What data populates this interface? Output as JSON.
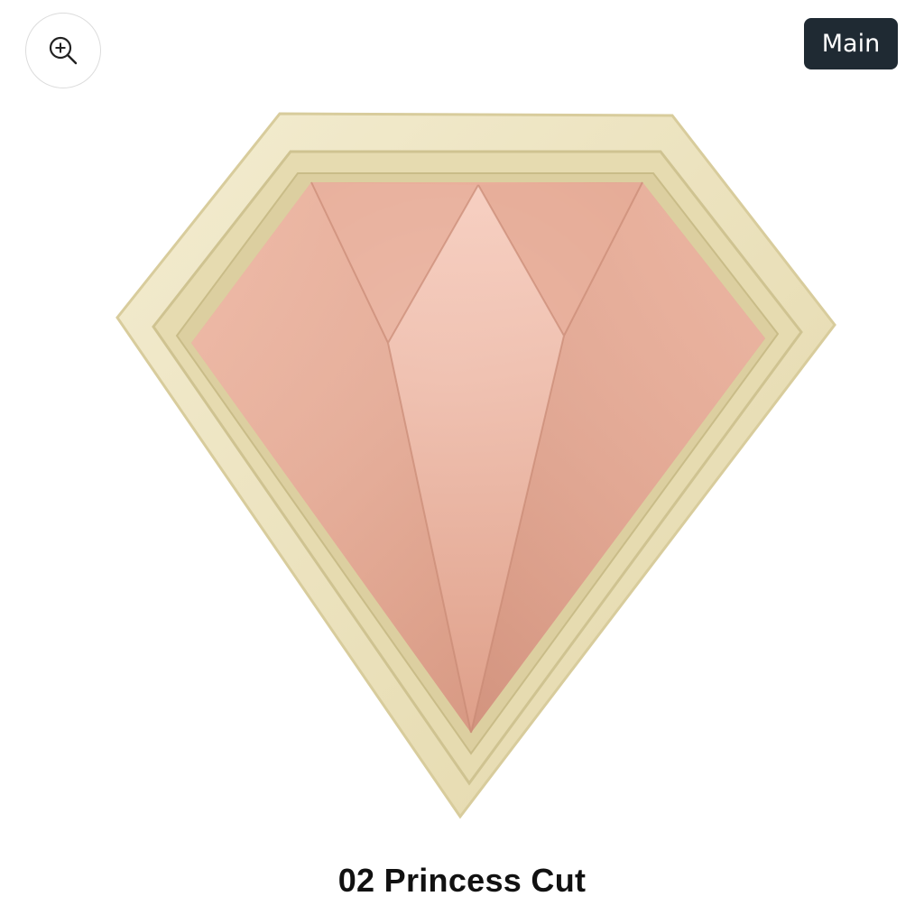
{
  "toolbar": {
    "zoom_icon": "zoom-in-icon",
    "badge_label": "Main"
  },
  "product": {
    "caption": "02 Princess Cut",
    "colors": {
      "case": "#e9dfb8",
      "case_shadow": "#cfc391",
      "powder": "#e7aa94",
      "powder_highlight": "#f6cdbf",
      "powder_shadow": "#c98b78"
    }
  }
}
